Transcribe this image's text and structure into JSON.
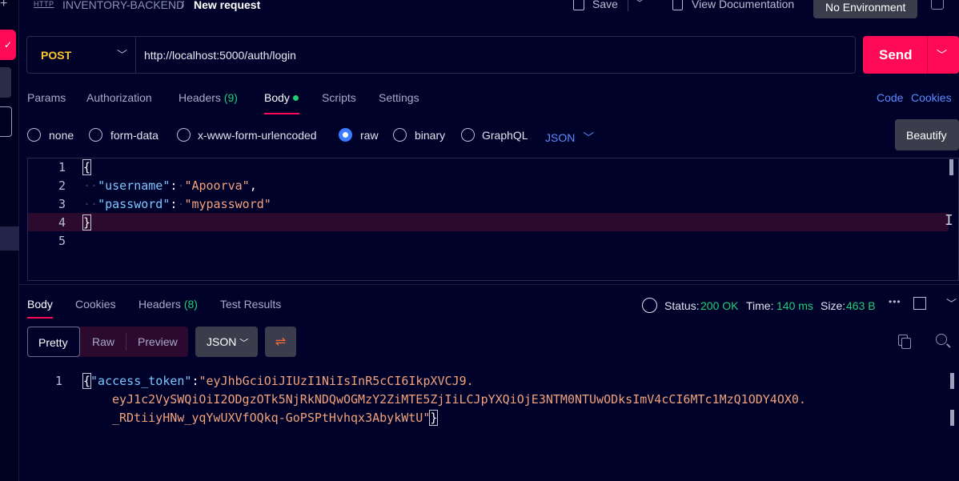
{
  "breadcrumb": {
    "icon_text": "HTTP",
    "collection": "INVENTORY-BACKEND",
    "separator": "/",
    "current": "New request"
  },
  "toolbar": {
    "save_label": "Save",
    "view_docs_label": "View Documentation",
    "environment": "No Environment"
  },
  "request": {
    "method": "POST",
    "url": "http://localhost:5000/auth/login",
    "send_label": "Send",
    "tabs": [
      {
        "label": "Params"
      },
      {
        "label": "Authorization"
      },
      {
        "label": "Headers",
        "count": "(9)"
      },
      {
        "label": "Body",
        "active": true
      },
      {
        "label": "Scripts"
      },
      {
        "label": "Settings"
      }
    ],
    "links": {
      "code": "Code",
      "cookies": "Cookies"
    },
    "body_types": [
      "none",
      "form-data",
      "x-www-form-urlencoded",
      "raw",
      "binary",
      "GraphQL"
    ],
    "selected_body_type": "raw",
    "format": "JSON",
    "beautify_label": "Beautify",
    "body_lines": {
      "open": "{",
      "username_key": "\"username\"",
      "username_val": "\"Apoorva\"",
      "password_key": "\"password\"",
      "password_val": "\"mypassword\"",
      "close": "}"
    },
    "line_numbers": [
      "1",
      "2",
      "3",
      "4",
      "5"
    ]
  },
  "response": {
    "tabs": [
      {
        "label": "Body",
        "active": true
      },
      {
        "label": "Cookies"
      },
      {
        "label": "Headers",
        "count": "(8)"
      },
      {
        "label": "Test Results"
      }
    ],
    "status_label": "Status:",
    "status_value": "200 OK",
    "time_label": "Time:",
    "time_value": "140 ms",
    "size_label": "Size:",
    "size_value": "463 B",
    "view_modes": [
      "Pretty",
      "Raw",
      "Preview"
    ],
    "format": "JSON",
    "line_number": "1",
    "token_key": "\"access_token\"",
    "token_line1": "\"eyJhbGciOiJIUzI1NiIsInR5cCI6IkpXVCJ9.",
    "token_line2": "eyJ1c2VySWQiOiI2ODgzOTk5NjRkNDQwOGMzY2ZiMTE5ZjIiLCJpYXQiOjE3NTM0NTUwODksImV4cCI6MTc1MzQ1ODY4OX0.",
    "token_line3": "_RDtiiyHNw_yqYwUXVfOQkq-GoPSPtHvhqx3AbykWtU\""
  },
  "colors": {
    "accent": "#ff0a55",
    "method": "#ffc82c",
    "success": "#1fcf75",
    "link": "#5b8cff"
  }
}
